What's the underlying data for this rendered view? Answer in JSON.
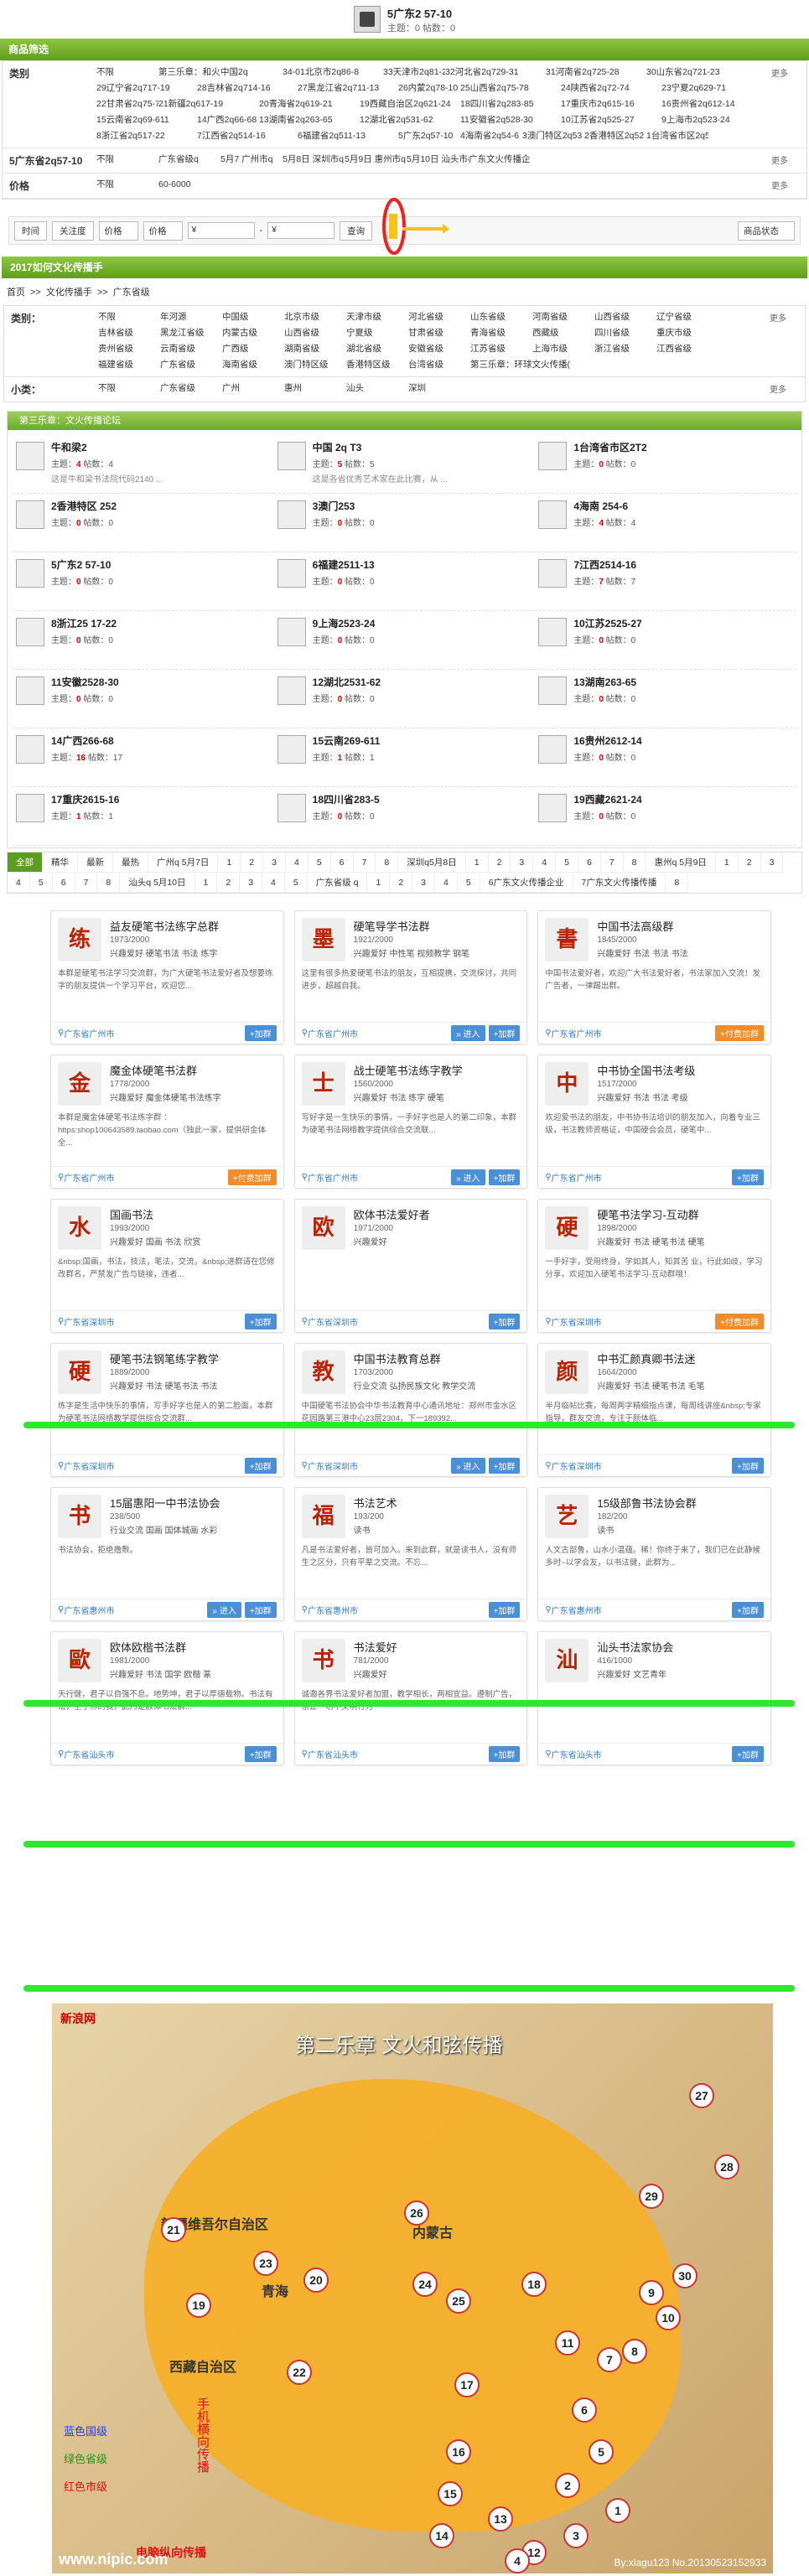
{
  "top": {
    "title": "5广东2 57-10",
    "meta": "主题：0 帖数：0"
  },
  "filter": {
    "header": "商品筛选",
    "more": "更多",
    "rows": [
      {
        "label": "类别",
        "opts": [
          "不限",
          "第三乐章：和火传递",
          "中国2q",
          "34-01北京市2q86-8",
          "33天津市2q81-2",
          "32河北省2q729-31",
          "31河南省2q725-28",
          "30山东省2q721-23",
          "29辽宁省2q717-19",
          "28吉林省2q714-16",
          "27黑龙江省2q711-13",
          "26内蒙2q78-10",
          "25山西省2q75-78",
          "24陕西省2q72-74",
          "23宁夏2q629-71",
          "22甘肃省2q75-7",
          "21新疆2q617-19",
          "20青海省2q619-21",
          "19西藏自治区2q621-24",
          "18四川省2q283-85",
          "17重庆市2q615-16",
          "16贵州省2q612-14",
          "15云南省2q69-611",
          "14广西2q66-68",
          "13湖南省2q263-65",
          "12湖北省2q531-62",
          "11安徽省2q528-30",
          "10江苏省2q525-27",
          "9上海市2q523-24",
          "8浙江省2q517-22",
          "7江西省2q514-16",
          "6福建省2q511-13",
          "5广东2q57-10",
          "4海南省2q54-6",
          "3澳门特区2q53",
          "2香港特区2q52",
          "1台湾省市区2q51"
        ]
      },
      {
        "label": "5广东省2q57-10",
        "opts": [
          "不限",
          "广东省级q",
          "5月7 广州市q",
          "5月8日 深圳市q",
          "5月9日 惠州市q",
          "5月10日 汕头市q",
          "广东文火传播企业"
        ]
      },
      {
        "label": "价格",
        "opts": [
          "不限",
          "60-6000"
        ]
      }
    ]
  },
  "sort": {
    "time": "时间",
    "focus": "关注度",
    "price_up": "价格",
    "price_down": "价格",
    "cur1": "¥",
    "cur2": "¥",
    "query": "查询",
    "status": "商品状态"
  },
  "cat2": {
    "header": "2017如何文化传播手",
    "crumbs": [
      "首页",
      ">>",
      "文化传播手",
      ">>",
      "广东省级"
    ],
    "label1": "类别：",
    "more": "更多",
    "opts": [
      "不限",
      "年河源",
      "中国级",
      "北京市级",
      "天津市级",
      "河北省级",
      "山东省级",
      "河南省级",
      "山西省级",
      "辽宁省级",
      "吉林省级",
      "黑龙江省级",
      "内蒙古级",
      "山西省级",
      "宁夏级",
      "甘肃省级",
      "青海省级",
      "西藏级",
      "四川省级",
      "重庆市级",
      "贵州省级",
      "云南省级",
      "广西级",
      "湖南省级",
      "湖北省级",
      "安徽省级",
      "江苏省级",
      "上海市级",
      "浙江省级",
      "江西省级",
      "福建省级",
      "广东省级",
      "海南省级",
      "澳门特区级",
      "香港特区级",
      "台湾省级",
      "第三乐章：环球文火传播(省)"
    ],
    "label2": "小类：",
    "sub": [
      "不限",
      "广东省级",
      "广州",
      "惠州",
      "汕头",
      "深圳"
    ]
  },
  "sec3": {
    "header": "第三乐章：文火传播论坛",
    "items": [
      {
        "name": "牛和梁2",
        "topics": "4",
        "posts": "4",
        "desc": "这是牛和梁书法院代码2140 ..."
      },
      {
        "name": "中国 2q T3",
        "topics": "5",
        "posts": "5",
        "desc": "这是各省优秀艺术家在此比赛，从 ..."
      },
      {
        "name": "1台湾省市区2T2",
        "topics": "0",
        "posts": "0",
        "desc": ""
      },
      {
        "name": "2香港特区 252",
        "topics": "0",
        "posts": "0",
        "desc": ""
      },
      {
        "name": "3澳门253",
        "topics": "0",
        "posts": "0",
        "desc": ""
      },
      {
        "name": "4海南 254-6",
        "topics": "4",
        "posts": "4",
        "desc": ""
      },
      {
        "name": "5广东2 57-10",
        "topics": "0",
        "posts": "0",
        "desc": ""
      },
      {
        "name": "6福建2511-13",
        "topics": "0",
        "posts": "0",
        "desc": ""
      },
      {
        "name": "7江西2514-16",
        "topics": "7",
        "posts": "7",
        "desc": ""
      },
      {
        "name": "8浙江25 17-22",
        "topics": "0",
        "posts": "0",
        "desc": ""
      },
      {
        "name": "9上海2523-24",
        "topics": "0",
        "posts": "0",
        "desc": ""
      },
      {
        "name": "10江苏2525-27",
        "topics": "0",
        "posts": "0",
        "desc": ""
      },
      {
        "name": "11安徽2528-30",
        "topics": "0",
        "posts": "0",
        "desc": ""
      },
      {
        "name": "12湖北2531-62",
        "topics": "0",
        "posts": "0",
        "desc": ""
      },
      {
        "name": "13湖南263-65",
        "topics": "0",
        "posts": "0",
        "desc": ""
      },
      {
        "name": "14广西266-68",
        "topics": "16",
        "posts": "17",
        "desc": ""
      },
      {
        "name": "15云南269-611",
        "topics": "1",
        "posts": "1",
        "desc": ""
      },
      {
        "name": "16贵州2612-14",
        "topics": "0",
        "posts": "0",
        "desc": ""
      },
      {
        "name": "17重庆2615-16",
        "topics": "1",
        "posts": "1",
        "desc": ""
      },
      {
        "name": "18四川省283-5",
        "topics": "0",
        "posts": "0",
        "desc": ""
      },
      {
        "name": "19西藏2621-24",
        "topics": "0",
        "posts": "0",
        "desc": ""
      }
    ],
    "topics_label": "主题：",
    "posts_label": "帖数："
  },
  "pager": [
    "全部",
    "精华",
    "最新",
    "最热",
    "广州q 5月7日",
    "1",
    "2",
    "3",
    "4",
    "5",
    "6",
    "7",
    "8",
    "深圳q5月8日",
    "1",
    "2",
    "3",
    "4",
    "5",
    "6",
    "7",
    "8",
    "惠州q 5月9日",
    "1",
    "2",
    "3",
    "4",
    "5",
    "6",
    "7",
    "8",
    "汕头q 5月10日",
    "1",
    "2",
    "3",
    "4",
    "5",
    "广东省级 q",
    "1",
    "2",
    "3",
    "4",
    "5",
    "6广东文火传播企业",
    "7广东文火传播传播",
    "8"
  ],
  "groups": [
    {
      "av": "练",
      "name": "益友硬笔书法练字总群",
      "num": "1973/2000",
      "tags": "兴趣爱好 硬笔书法 书法 练字",
      "desc": "本群是硬笔书法学习交流群，为广大硬笔书法爱好者及想要练字的朋友提供一个学习平台，欢迎您...",
      "loc": "广东省广州市",
      "btn": "+加群"
    },
    {
      "av": "墨",
      "name": "硬笔导学书法群",
      "num": "1921/2000",
      "tags": "兴趣爱好 中性笔 视频教学 钢笔",
      "desc": "这里有很多热爱硬笔书法的朋友，互相提携，交流探讨，共同进步，超越自我。",
      "loc": "广东省广州市",
      "btn": "+加群"
    },
    {
      "av": "書",
      "name": "中国书法高级群",
      "num": "1845/2000",
      "tags": "兴趣爱好 书法 书法 书法",
      "desc": "中国书法爱好者，欢迎广大书法爱好者，书法家加入交流！发广告者，一律踢出群。",
      "loc": "广东省广州市",
      "btn": "+付费加群"
    },
    {
      "av": "金",
      "name": "魔金体硬笔书法群",
      "num": "1778/2000",
      "tags": "兴趣爱好 魔金体硬笔书法练字",
      "desc": "本群是魔金体硬笔书法练字群 ：https:shop100643589.taobao.com（独此一家，提供研金体全...",
      "loc": "广东省广州市",
      "btn": "+付费加群"
    },
    {
      "av": "士",
      "name": "战士硬笔书法练字教学",
      "num": "1560/2000",
      "tags": "兴趣爱好 书法 练字 硬笔",
      "desc": "写好字是一生快乐的事情，一手好字也是人的第二印象，本群为硬笔书法网络教学提供综合交流联...",
      "loc": "广东省广州市",
      "btn": "+加群"
    },
    {
      "av": "中",
      "name": "中书协全国书法考级",
      "num": "1517/2000",
      "tags": "兴趣爱好 书法 书法 考级",
      "desc": "欢迎爱书法的朋友，中书协书法培训的朋友加入，向着专业三级，书法教师资格证，中国硬会会员，硬笔中...",
      "loc": "广东省广州市",
      "btn": "+加群"
    },
    {
      "av": "水",
      "name": "国画书法",
      "num": "1993/2000",
      "tags": "兴趣爱好 国画 书法 欣赏",
      "desc": "&nbsp;国画，书法，技法，笔法，交流，&nbsp;进群请在您修改群名，严禁发广告与链接，违者...",
      "loc": "广东省深圳市",
      "btn": "+加群"
    },
    {
      "av": "欧",
      "name": "欧体书法爱好者",
      "num": "1971/2000",
      "tags": "兴趣爱好",
      "desc": "",
      "loc": "广东省深圳市",
      "btn": "+加群"
    },
    {
      "av": "硬",
      "name": "硬笔书法学习-互动群",
      "num": "1898/2000",
      "tags": "兴趣爱好 书法 硬笔书法 硬笔",
      "desc": "一手好字，受用终身，学如其人，知其苦 业，行此如歧，学习分享，欢迎加入硬笔书法学习-互动群哦！",
      "loc": "广东省深圳市",
      "btn": "+付费加群"
    },
    {
      "av": "硬",
      "name": "硬笔书法钢笔练字教学",
      "num": "1889/2000",
      "tags": "兴趣爱好 书法 硬笔书法 书法",
      "desc": "练字是生活中快乐的事情，写手好字也是人的第二脸面，本群为硬笔书法网络教学提供综合交流群...",
      "loc": "广东省深圳市",
      "btn": "+加群"
    },
    {
      "av": "教",
      "name": "中国书法教育总群",
      "num": "1703/2000",
      "tags": "行业交流 弘扬民族文化 教学交流",
      "desc": "中国硬笔书法协会中华书法教育中心通讯地址：郑州市金水区花园路第三港中心23层2304，下一189392...",
      "loc": "广东省深圳市",
      "btn": "+加群"
    },
    {
      "av": "颜",
      "name": "中书汇颜真卿书法迷",
      "num": "1664/2000",
      "tags": "兴趣爱好 书法 硬笔书法 毛笔",
      "desc": "半月临帖比赛，每周两字精细指点课，每周线讲座&nbsp;专家指导，群友交流，专注于颜体临...",
      "loc": "广东省深圳市",
      "btn": "+加群"
    },
    {
      "av": "书",
      "name": "15届惠阳一中书法协会",
      "num": "238/500",
      "tags": "行业交流 国画 国体城画 水彩",
      "desc": "书法协会，拒绝撸敷。",
      "loc": "广东省惠州市",
      "btn": "+加群"
    },
    {
      "av": "福",
      "name": "书法艺术",
      "num": "193/200",
      "tags": "读书",
      "desc": "凡是书法爱好者，皆可加入。来到此群，就是读书人，没有师生之区分，只有平辈之交流。不忘...",
      "loc": "广东省惠州市",
      "btn": "+加群"
    },
    {
      "av": "艺",
      "name": "15级部鲁书法协会群",
      "num": "182/200",
      "tags": "读书",
      "desc": "人文古部鲁，山水小温蕴。稀！你终于来了，我们已在此静候多时~以学会友，以书法健，此群为...",
      "loc": "广东省惠州市",
      "btn": "+加群"
    },
    {
      "av": "歐",
      "name": "欧体欧楷书法群",
      "num": "1981/2000",
      "tags": "兴趣爱好 书法 国学 欧楷 篆",
      "desc": "天行健，君子以自强不息。地势坤，君子以厚德载物。书法有法，生于你的我，此乃是欧体书法群...",
      "loc": "广东省汕头市",
      "btn": "+加群"
    },
    {
      "av": "书",
      "name": "书法爱好",
      "num": "781/2000",
      "tags": "兴趣爱好",
      "desc": "诚邀各界书法爱好者加盟，教学相长，两相宜益。遵制广告，禁止一切不文明行为",
      "loc": "广东省汕头市",
      "btn": "+加群"
    },
    {
      "av": "汕",
      "name": "汕头书法家协会",
      "num": "416/1000",
      "tags": "兴趣爱好 文艺青年",
      "desc": "",
      "loc": "广东省汕头市",
      "btn": "+加群"
    }
  ],
  "group_enter": "» 进入",
  "map": {
    "logo": "新浪网",
    "title": "第二乐章 文火和弦传播",
    "legend": [
      "蓝色国级",
      "绿色省级",
      "红色市级"
    ],
    "side": "手机横向传播",
    "side2": "电脑纵向传播",
    "watermark": "www.nipic.com",
    "sig": "By:xiagu123 No.20130523152933",
    "provs": [
      "新疆维吾尔自治区",
      "西藏自治区",
      "内蒙古",
      "青海"
    ],
    "nums": [
      "27",
      "28",
      "29",
      "30",
      "21",
      "23",
      "26",
      "20",
      "19",
      "22",
      "24",
      "25",
      "18",
      "16",
      "15",
      "14",
      "13",
      "12",
      "17",
      "3",
      "4",
      "2",
      "1",
      "5",
      "6",
      "7",
      "8",
      "9",
      "10",
      "11"
    ]
  }
}
